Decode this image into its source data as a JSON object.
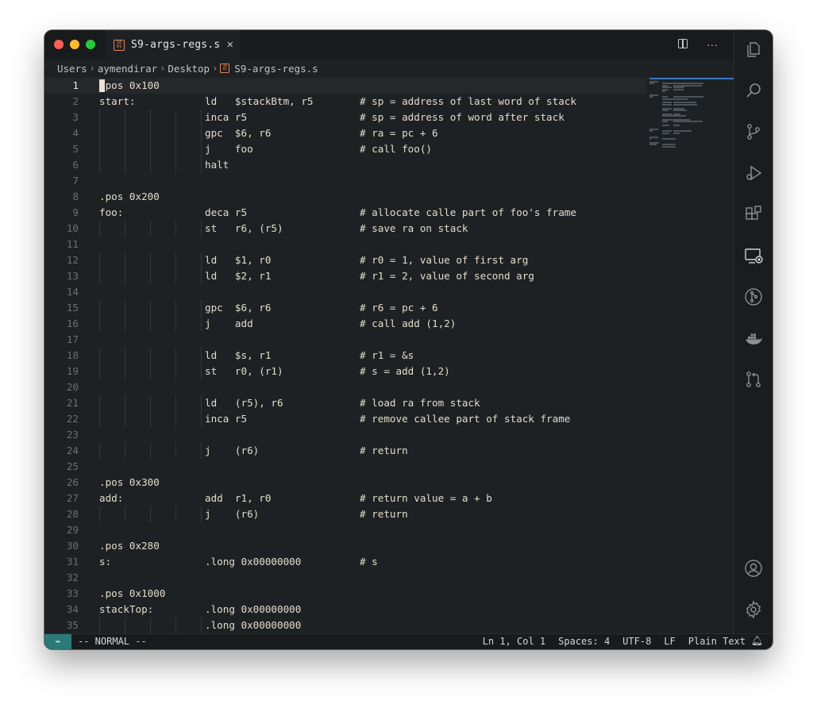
{
  "tab": {
    "icon_text": "10 01",
    "label": "S9-args-regs.s",
    "close": "×"
  },
  "title_actions": {
    "more": "···"
  },
  "breadcrumb": {
    "parts": [
      "Users",
      "aymendirar",
      "Desktop"
    ],
    "file": "S9-args-regs.s"
  },
  "editor": {
    "current_line": 1,
    "lines": [
      {
        "n": "1",
        "label": ".pos 0x100",
        "instr": "",
        "comment": ""
      },
      {
        "n": "2",
        "label": "start:",
        "instr": "ld   $stackBtm, r5",
        "comment": "# sp = address of last word of stack"
      },
      {
        "n": "3",
        "label": "",
        "instr": "inca r5",
        "comment": "# sp = address of word after stack"
      },
      {
        "n": "4",
        "label": "",
        "instr": "gpc  $6, r6",
        "comment": "# ra = pc + 6"
      },
      {
        "n": "5",
        "label": "",
        "instr": "j    foo",
        "comment": "# call foo()"
      },
      {
        "n": "6",
        "label": "",
        "instr": "halt",
        "comment": ""
      },
      {
        "n": "7",
        "label": "",
        "instr": "",
        "comment": ""
      },
      {
        "n": "8",
        "label": ".pos 0x200",
        "instr": "",
        "comment": ""
      },
      {
        "n": "9",
        "label": "foo:",
        "instr": "deca r5",
        "comment": "# allocate calle part of foo's frame"
      },
      {
        "n": "10",
        "label": "",
        "instr": "st   r6, (r5)",
        "comment": "# save ra on stack"
      },
      {
        "n": "11",
        "label": "",
        "instr": "",
        "comment": ""
      },
      {
        "n": "12",
        "label": "",
        "instr": "ld   $1, r0",
        "comment": "# r0 = 1, value of first arg"
      },
      {
        "n": "13",
        "label": "",
        "instr": "ld   $2, r1",
        "comment": "# r1 = 2, value of second arg"
      },
      {
        "n": "14",
        "label": "",
        "instr": "",
        "comment": ""
      },
      {
        "n": "15",
        "label": "",
        "instr": "gpc  $6, r6",
        "comment": "# r6 = pc + 6"
      },
      {
        "n": "16",
        "label": "",
        "instr": "j    add",
        "comment": "# call add (1,2)"
      },
      {
        "n": "17",
        "label": "",
        "instr": "",
        "comment": ""
      },
      {
        "n": "18",
        "label": "",
        "instr": "ld   $s, r1",
        "comment": "# r1 = &s"
      },
      {
        "n": "19",
        "label": "",
        "instr": "st   r0, (r1)",
        "comment": "# s = add (1,2)"
      },
      {
        "n": "20",
        "label": "",
        "instr": "",
        "comment": ""
      },
      {
        "n": "21",
        "label": "",
        "instr": "ld   (r5), r6",
        "comment": "# load ra from stack"
      },
      {
        "n": "22",
        "label": "",
        "instr": "inca r5",
        "comment": "# remove callee part of stack frame"
      },
      {
        "n": "23",
        "label": "",
        "instr": "",
        "comment": ""
      },
      {
        "n": "24",
        "label": "",
        "instr": "j    (r6)",
        "comment": "# return"
      },
      {
        "n": "25",
        "label": "",
        "instr": "",
        "comment": ""
      },
      {
        "n": "26",
        "label": ".pos 0x300",
        "instr": "",
        "comment": ""
      },
      {
        "n": "27",
        "label": "add:",
        "instr": "add  r1, r0",
        "comment": "# return value = a + b"
      },
      {
        "n": "28",
        "label": "",
        "instr": "j    (r6)",
        "comment": "# return"
      },
      {
        "n": "29",
        "label": "",
        "instr": "",
        "comment": ""
      },
      {
        "n": "30",
        "label": ".pos 0x280",
        "instr": "",
        "comment": ""
      },
      {
        "n": "31",
        "label": "s:",
        "instr": ".long 0x00000000",
        "comment": "# s"
      },
      {
        "n": "32",
        "label": "",
        "instr": "",
        "comment": ""
      },
      {
        "n": "33",
        "label": ".pos 0x1000",
        "instr": "",
        "comment": ""
      },
      {
        "n": "34",
        "label": "stackTop:",
        "instr": ".long 0x00000000",
        "comment": ""
      },
      {
        "n": "35",
        "label": "",
        "instr": ".long 0x00000000",
        "comment": ""
      }
    ]
  },
  "activity_bar": [
    "files-icon",
    "search-icon",
    "source-control-icon",
    "run-debug-icon",
    "extensions-icon",
    "remote-explorer-icon",
    "git-graph-icon",
    "docker-icon",
    "pull-request-icon",
    "account-icon",
    "settings-gear-icon"
  ],
  "statusbar": {
    "remote": "⌁",
    "mode": "-- NORMAL --",
    "position": "Ln 1, Col 1",
    "spaces": "Spaces: 4",
    "encoding": "UTF-8",
    "eol": "LF",
    "language": "Plain Text"
  },
  "colors": {
    "editor_bg": "#1e2124",
    "text": "#e2dccb",
    "line_number": "#6b6f73",
    "file_icon": "#e28453",
    "remote_indicator": "#2b7a78"
  }
}
